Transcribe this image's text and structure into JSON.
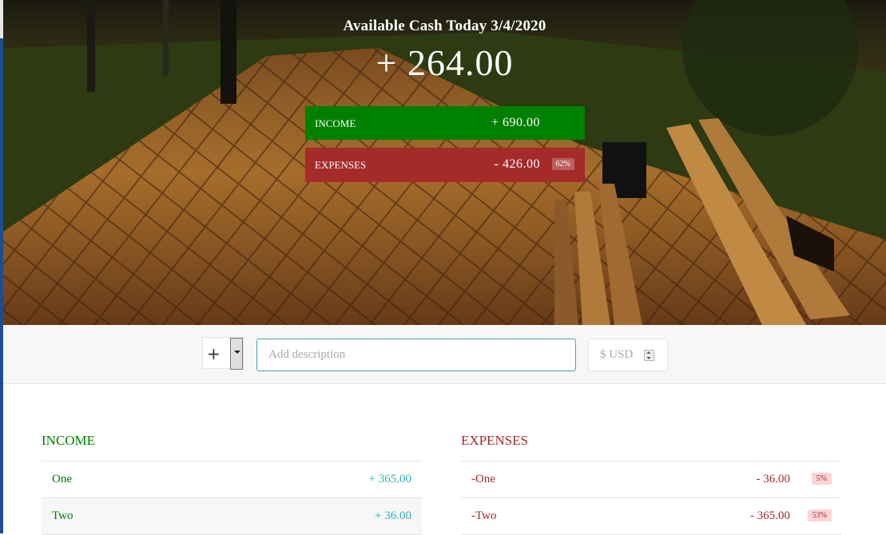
{
  "header": {
    "title": "Available Cash Today 3/4/2020",
    "total": "+ 264.00",
    "income": {
      "label": "INCOME",
      "value": "+ 690.00"
    },
    "expenses": {
      "label": "EXPENSES",
      "value": "- 426.00",
      "percentage": "62%"
    }
  },
  "input_bar": {
    "type_value": "+",
    "description_placeholder": "Add description",
    "amount_placeholder": "$ USD"
  },
  "income_list": {
    "title": "INCOME",
    "items": [
      {
        "description": "One",
        "value": "+ 365.00"
      },
      {
        "description": "Two",
        "value": "+ 36.00"
      }
    ]
  },
  "expenses_list": {
    "title": "EXPENSES",
    "items": [
      {
        "description": "-One",
        "value": "- 36.00",
        "percentage": "5%"
      },
      {
        "description": "-Two",
        "value": "- 365.00",
        "percentage": "53%"
      }
    ]
  },
  "colors": {
    "income": "#008000",
    "expenses": "#a52a2a",
    "accent": "#28b0b9"
  }
}
